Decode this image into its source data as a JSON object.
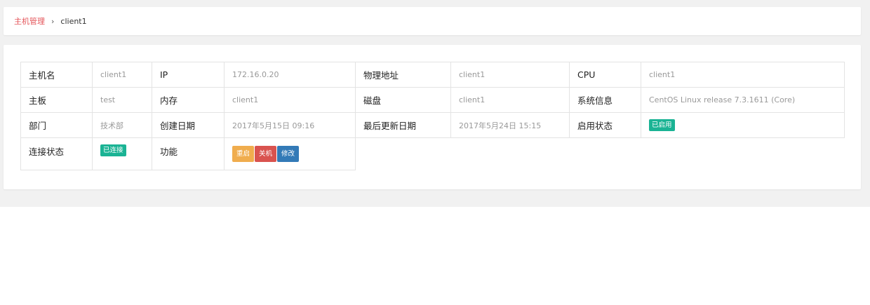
{
  "breadcrumb": {
    "parent": "主机管理",
    "separator": "›",
    "current": "client1"
  },
  "host": {
    "hostname_label": "主机名",
    "hostname_value": "client1",
    "ip_label": "IP",
    "ip_value": "172.16.0.20",
    "mac_label": "物理地址",
    "mac_value": "client1",
    "cpu_label": "CPU",
    "cpu_value": "client1",
    "board_label": "主板",
    "board_value": "test",
    "memory_label": "内存",
    "memory_value": "client1",
    "disk_label": "磁盘",
    "disk_value": "client1",
    "sysinfo_label": "系统信息",
    "sysinfo_value": "CentOS Linux release 7.3.1611 (Core)",
    "dept_label": "部门",
    "dept_value": "技术部",
    "created_label": "创建日期",
    "created_value": "2017年5月15日 09:16",
    "updated_label": "最后更新日期",
    "updated_value": "2017年5月24日 15:15",
    "enabled_label": "启用状态",
    "enabled_badge": "已启用",
    "conn_label": "连接状态",
    "conn_badge": "已连接",
    "func_label": "功能",
    "buttons": {
      "restart": "重启",
      "shutdown": "关机",
      "edit": "修改"
    }
  },
  "colors": {
    "breadcrumb_link": "#e4555a",
    "badge_green": "#1ab394",
    "btn_restart": "#f0ad4e",
    "btn_shutdown": "#d9534f",
    "btn_edit": "#337ab7"
  }
}
